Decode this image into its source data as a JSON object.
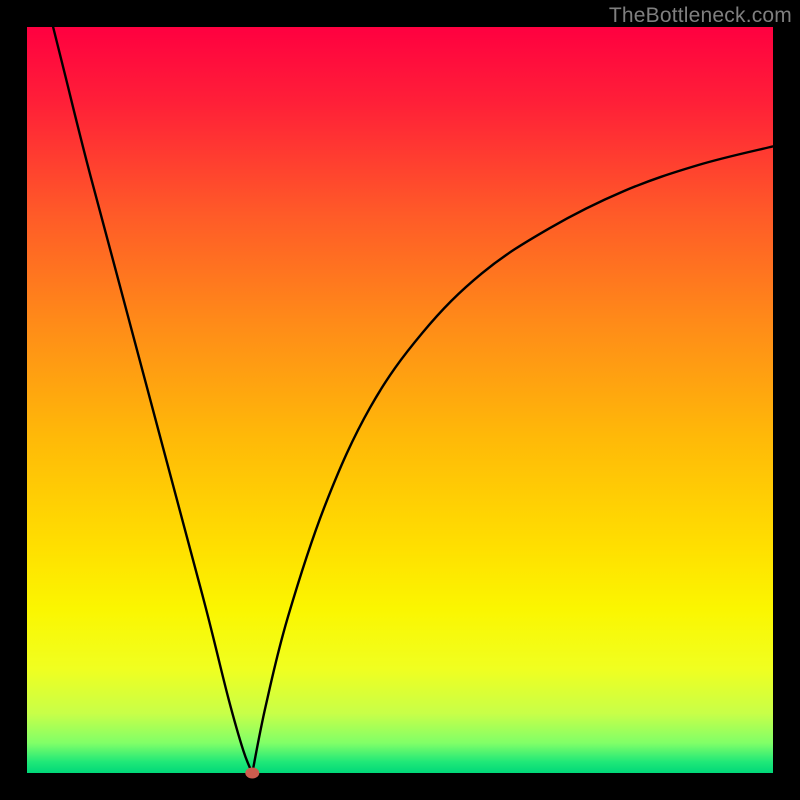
{
  "watermark": "TheBottleneck.com",
  "colors": {
    "frame": "#000000",
    "curve": "#000000",
    "marker": "#cd5c4e"
  },
  "gradient_stops": [
    {
      "offset": 0.0,
      "color": "#ff0040"
    },
    {
      "offset": 0.1,
      "color": "#ff1f38"
    },
    {
      "offset": 0.25,
      "color": "#ff5a28"
    },
    {
      "offset": 0.4,
      "color": "#ff8c18"
    },
    {
      "offset": 0.55,
      "color": "#ffb908"
    },
    {
      "offset": 0.7,
      "color": "#ffe000"
    },
    {
      "offset": 0.78,
      "color": "#fbf600"
    },
    {
      "offset": 0.86,
      "color": "#f0ff20"
    },
    {
      "offset": 0.92,
      "color": "#c8ff48"
    },
    {
      "offset": 0.96,
      "color": "#80ff68"
    },
    {
      "offset": 0.985,
      "color": "#20e878"
    },
    {
      "offset": 1.0,
      "color": "#00d879"
    }
  ],
  "chart_data": {
    "type": "line",
    "title": "",
    "xlabel": "",
    "ylabel": "",
    "xlim": [
      0,
      100
    ],
    "ylim": [
      0,
      100
    ],
    "grid": false,
    "series": [
      {
        "name": "left-branch",
        "x": [
          3.5,
          5,
          8,
          12,
          16,
          20,
          24,
          27,
          29,
          30.2
        ],
        "values": [
          100,
          94,
          82,
          67,
          52,
          37,
          22,
          10,
          3,
          0
        ]
      },
      {
        "name": "right-branch",
        "x": [
          30.2,
          32,
          35,
          40,
          46,
          53,
          61,
          70,
          80,
          90,
          100
        ],
        "values": [
          0,
          9,
          21,
          36,
          49,
          59,
          67,
          73,
          78,
          81.5,
          84
        ]
      }
    ],
    "marker": {
      "x": 30.2,
      "y": 0,
      "color": "#cd5c4e"
    }
  }
}
